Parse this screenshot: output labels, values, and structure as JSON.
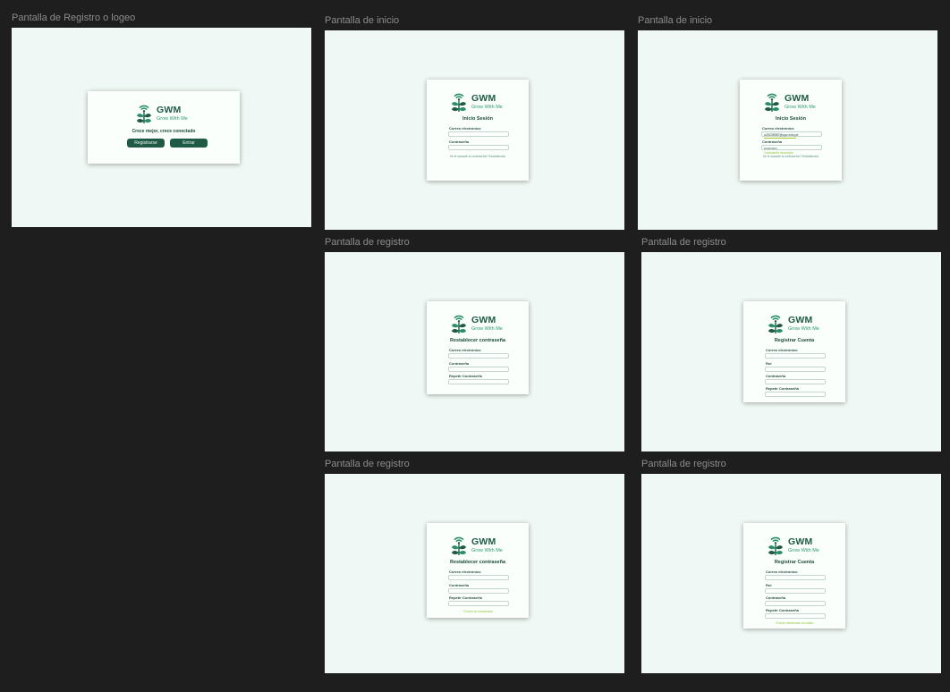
{
  "brand": {
    "name": "GWM",
    "tagline": "Grow With Me"
  },
  "colors": {
    "canvas": "#1e1e1e",
    "frame_bg": "#eff8f4",
    "card_bg": "#fafffc",
    "primary": "#1f5a47",
    "accent": "#2f9a72",
    "error": "#8dbf2c"
  },
  "frames": {
    "welcome": {
      "label": "Pantalla de Registro o logeo",
      "slogan": "Crece mejor, crece conectado",
      "register_label": "Registrarse",
      "enter_label": "Entrar"
    },
    "login": {
      "label": "Pantalla de inicio",
      "title": "Inicio Sesión",
      "email_label": "Correo electrónico",
      "password_label": "Contraseña",
      "forgot_text": "Se te sacaste la contraseña? Restablecelo"
    },
    "login_error": {
      "label": "Pantalla de inicio",
      "title": "Inicio Sesión",
      "email_label": "Correo electrónico",
      "email_value": "u20235987@upc.edu.pe",
      "password_label": "Contraseña",
      "password_value": "••••••••••••",
      "error_text": "Contraseña incorrecta",
      "forgot_text": "Se te sacaste la contraseña? Restablecelo"
    },
    "reset": {
      "label": "Pantalla de registro",
      "title": "Restablecer contraseña",
      "email_label": "Correo electrónico",
      "password_label": "Contraseña",
      "repeat_label": "Repetir Contraseña"
    },
    "signup": {
      "label": "Pantalla de registro",
      "title": "Registrar Cuenta",
      "email_label": "Correo electrónico",
      "role_label": "Rol",
      "password_label": "Contraseña",
      "repeat_label": "Repetir Contraseña"
    },
    "reset_error": {
      "label": "Pantalla de registro",
      "title": "Restablecer contraseña",
      "email_label": "Correo electrónico",
      "password_label": "Contraseña",
      "repeat_label": "Repetir Contraseña",
      "error_text": "*Correo no encontrado"
    },
    "signup_error": {
      "label": "Pantalla de registro",
      "title": "Registrar Cuenta",
      "email_label": "Correo electrónico",
      "role_label": "Rol",
      "password_label": "Contraseña",
      "repeat_label": "Repetir Contraseña",
      "error_text": "*Correo electrónico no válido"
    }
  },
  "icons": {
    "logo": "plant-wifi-icon"
  }
}
